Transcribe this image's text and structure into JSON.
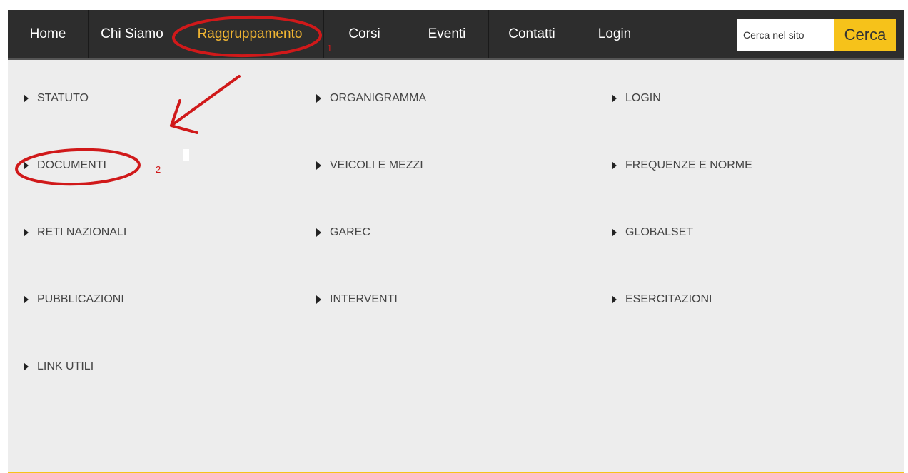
{
  "nav": {
    "items": [
      {
        "label": "Home",
        "active": false
      },
      {
        "label": "Chi Siamo",
        "active": false
      },
      {
        "label": "Raggruppamento",
        "active": true
      },
      {
        "label": "Corsi",
        "active": false
      },
      {
        "label": "Eventi",
        "active": false
      },
      {
        "label": "Contatti",
        "active": false
      },
      {
        "label": "Login",
        "active": false
      }
    ],
    "search_placeholder": "Cerca nel sito",
    "search_button": "Cerca"
  },
  "dropdown": {
    "items": [
      "STATUTO",
      "ORGANIGRAMMA",
      "LOGIN",
      "DOCUMENTI",
      "VEICOLI E MEZZI",
      "FREQUENZE E NORME",
      "RETI NAZIONALI",
      "GAREC",
      "GLOBALSET",
      "PUBBLICAZIONI",
      "INTERVENTI",
      "ESERCITAZIONI",
      "LINK UTILI"
    ]
  },
  "annotations": {
    "step1": "1",
    "step2": "2"
  },
  "colors": {
    "navbar": "#2d2d2d",
    "accent": "#f6c21a",
    "active_text": "#f2b632",
    "annotation": "#d0191a",
    "menu_bg": "#ededed"
  }
}
